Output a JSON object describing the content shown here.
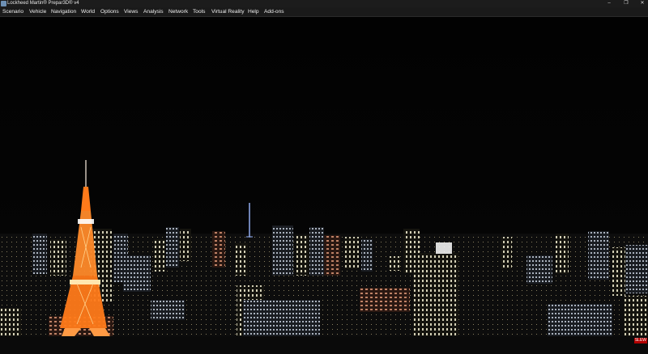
{
  "window": {
    "title": "Lockheed Martin® Prepar3D® v4",
    "app_icon": "prepar3d-app-icon",
    "controls": [
      {
        "name": "minimize-button",
        "glyph": "–"
      },
      {
        "name": "maximize-button",
        "glyph": "❐"
      },
      {
        "name": "close-button",
        "glyph": "✕"
      }
    ]
  },
  "menu": {
    "items": [
      {
        "label": "Scenario"
      },
      {
        "label": "Vehicle"
      },
      {
        "label": "Navigation"
      },
      {
        "label": "World"
      },
      {
        "label": "Options"
      },
      {
        "label": "Views"
      },
      {
        "label": "Analysis"
      },
      {
        "label": "Network"
      },
      {
        "label": "Tools"
      },
      {
        "label": "Virtual Reality"
      },
      {
        "label": "Help"
      },
      {
        "label": "Add-ons"
      }
    ]
  },
  "scene": {
    "description_icon": "night-city-view",
    "sky_color": "#020202",
    "tower_color": "#ff7a1a",
    "badge": "SLEW"
  }
}
